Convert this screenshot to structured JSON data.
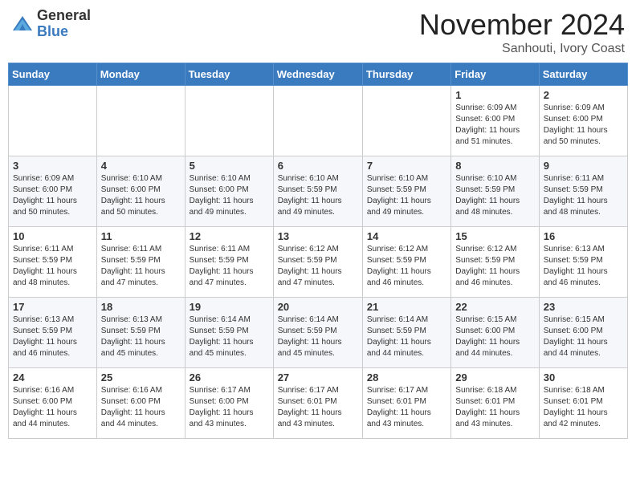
{
  "logo": {
    "general": "General",
    "blue": "Blue"
  },
  "header": {
    "month": "November 2024",
    "location": "Sanhouti, Ivory Coast"
  },
  "weekdays": [
    "Sunday",
    "Monday",
    "Tuesday",
    "Wednesday",
    "Thursday",
    "Friday",
    "Saturday"
  ],
  "weeks": [
    [
      {
        "day": "",
        "info": ""
      },
      {
        "day": "",
        "info": ""
      },
      {
        "day": "",
        "info": ""
      },
      {
        "day": "",
        "info": ""
      },
      {
        "day": "",
        "info": ""
      },
      {
        "day": "1",
        "info": "Sunrise: 6:09 AM\nSunset: 6:00 PM\nDaylight: 11 hours\nand 51 minutes."
      },
      {
        "day": "2",
        "info": "Sunrise: 6:09 AM\nSunset: 6:00 PM\nDaylight: 11 hours\nand 50 minutes."
      }
    ],
    [
      {
        "day": "3",
        "info": "Sunrise: 6:09 AM\nSunset: 6:00 PM\nDaylight: 11 hours\nand 50 minutes."
      },
      {
        "day": "4",
        "info": "Sunrise: 6:10 AM\nSunset: 6:00 PM\nDaylight: 11 hours\nand 50 minutes."
      },
      {
        "day": "5",
        "info": "Sunrise: 6:10 AM\nSunset: 6:00 PM\nDaylight: 11 hours\nand 49 minutes."
      },
      {
        "day": "6",
        "info": "Sunrise: 6:10 AM\nSunset: 5:59 PM\nDaylight: 11 hours\nand 49 minutes."
      },
      {
        "day": "7",
        "info": "Sunrise: 6:10 AM\nSunset: 5:59 PM\nDaylight: 11 hours\nand 49 minutes."
      },
      {
        "day": "8",
        "info": "Sunrise: 6:10 AM\nSunset: 5:59 PM\nDaylight: 11 hours\nand 48 minutes."
      },
      {
        "day": "9",
        "info": "Sunrise: 6:11 AM\nSunset: 5:59 PM\nDaylight: 11 hours\nand 48 minutes."
      }
    ],
    [
      {
        "day": "10",
        "info": "Sunrise: 6:11 AM\nSunset: 5:59 PM\nDaylight: 11 hours\nand 48 minutes."
      },
      {
        "day": "11",
        "info": "Sunrise: 6:11 AM\nSunset: 5:59 PM\nDaylight: 11 hours\nand 47 minutes."
      },
      {
        "day": "12",
        "info": "Sunrise: 6:11 AM\nSunset: 5:59 PM\nDaylight: 11 hours\nand 47 minutes."
      },
      {
        "day": "13",
        "info": "Sunrise: 6:12 AM\nSunset: 5:59 PM\nDaylight: 11 hours\nand 47 minutes."
      },
      {
        "day": "14",
        "info": "Sunrise: 6:12 AM\nSunset: 5:59 PM\nDaylight: 11 hours\nand 46 minutes."
      },
      {
        "day": "15",
        "info": "Sunrise: 6:12 AM\nSunset: 5:59 PM\nDaylight: 11 hours\nand 46 minutes."
      },
      {
        "day": "16",
        "info": "Sunrise: 6:13 AM\nSunset: 5:59 PM\nDaylight: 11 hours\nand 46 minutes."
      }
    ],
    [
      {
        "day": "17",
        "info": "Sunrise: 6:13 AM\nSunset: 5:59 PM\nDaylight: 11 hours\nand 46 minutes."
      },
      {
        "day": "18",
        "info": "Sunrise: 6:13 AM\nSunset: 5:59 PM\nDaylight: 11 hours\nand 45 minutes."
      },
      {
        "day": "19",
        "info": "Sunrise: 6:14 AM\nSunset: 5:59 PM\nDaylight: 11 hours\nand 45 minutes."
      },
      {
        "day": "20",
        "info": "Sunrise: 6:14 AM\nSunset: 5:59 PM\nDaylight: 11 hours\nand 45 minutes."
      },
      {
        "day": "21",
        "info": "Sunrise: 6:14 AM\nSunset: 5:59 PM\nDaylight: 11 hours\nand 44 minutes."
      },
      {
        "day": "22",
        "info": "Sunrise: 6:15 AM\nSunset: 6:00 PM\nDaylight: 11 hours\nand 44 minutes."
      },
      {
        "day": "23",
        "info": "Sunrise: 6:15 AM\nSunset: 6:00 PM\nDaylight: 11 hours\nand 44 minutes."
      }
    ],
    [
      {
        "day": "24",
        "info": "Sunrise: 6:16 AM\nSunset: 6:00 PM\nDaylight: 11 hours\nand 44 minutes."
      },
      {
        "day": "25",
        "info": "Sunrise: 6:16 AM\nSunset: 6:00 PM\nDaylight: 11 hours\nand 44 minutes."
      },
      {
        "day": "26",
        "info": "Sunrise: 6:17 AM\nSunset: 6:00 PM\nDaylight: 11 hours\nand 43 minutes."
      },
      {
        "day": "27",
        "info": "Sunrise: 6:17 AM\nSunset: 6:01 PM\nDaylight: 11 hours\nand 43 minutes."
      },
      {
        "day": "28",
        "info": "Sunrise: 6:17 AM\nSunset: 6:01 PM\nDaylight: 11 hours\nand 43 minutes."
      },
      {
        "day": "29",
        "info": "Sunrise: 6:18 AM\nSunset: 6:01 PM\nDaylight: 11 hours\nand 43 minutes."
      },
      {
        "day": "30",
        "info": "Sunrise: 6:18 AM\nSunset: 6:01 PM\nDaylight: 11 hours\nand 42 minutes."
      }
    ]
  ]
}
